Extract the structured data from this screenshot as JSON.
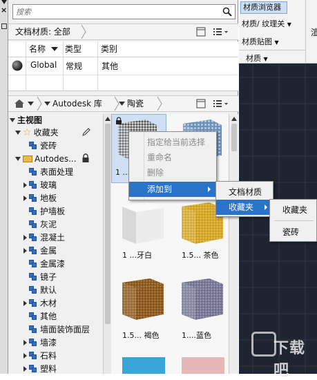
{
  "search": {
    "placeholder": "搜索"
  },
  "doc_materials": {
    "breadcrumb": "文档材质: 全部",
    "columns": [
      "名称",
      "类型",
      "类别"
    ],
    "rows": [
      {
        "name": "Global",
        "type": "常规",
        "category": "其他"
      }
    ]
  },
  "library_bar": {
    "crumb1": "Autodesk 库",
    "crumb2": "陶瓷"
  },
  "tree": {
    "root": "主视图",
    "favorites": "收藏夹",
    "fav_child": "瓷砖",
    "autodesk": "Autodes...",
    "items": [
      "表面处理",
      "玻璃",
      "地板",
      "护墙板",
      "灰泥",
      "混凝土",
      "金属",
      "金属漆",
      "镜子",
      "默认",
      "木材",
      "其他",
      "墙面装饰面层",
      "墙漆",
      "石料",
      "塑料"
    ]
  },
  "swatches": [
    {
      "label": "1 ..."
    },
    {
      "label": ""
    },
    {
      "label": "1 ...牙白"
    },
    {
      "label": "1.5... 茶色"
    },
    {
      "label": "1.5... 褐色"
    },
    {
      "label": "1....蓝色"
    }
  ],
  "context_menu": {
    "items": [
      "指定给当前选择",
      "重命名",
      "删除",
      "添加到"
    ],
    "submenu1": [
      "文档材质",
      "收藏夹"
    ],
    "submenu2": [
      "收藏夹",
      "瓷砖"
    ]
  },
  "ribbon": {
    "browser_btn": "材质浏览器",
    "texture_btn": "材质/ 纹理关",
    "mapping_btn": "材质贴图",
    "group_label": "材质",
    "cut_text": "渲"
  },
  "watermark": {
    "text": "下载吧"
  },
  "colors": {
    "accent": "#2b72c9",
    "panel": "#f0f0f0",
    "viewport": "#1e2430"
  }
}
